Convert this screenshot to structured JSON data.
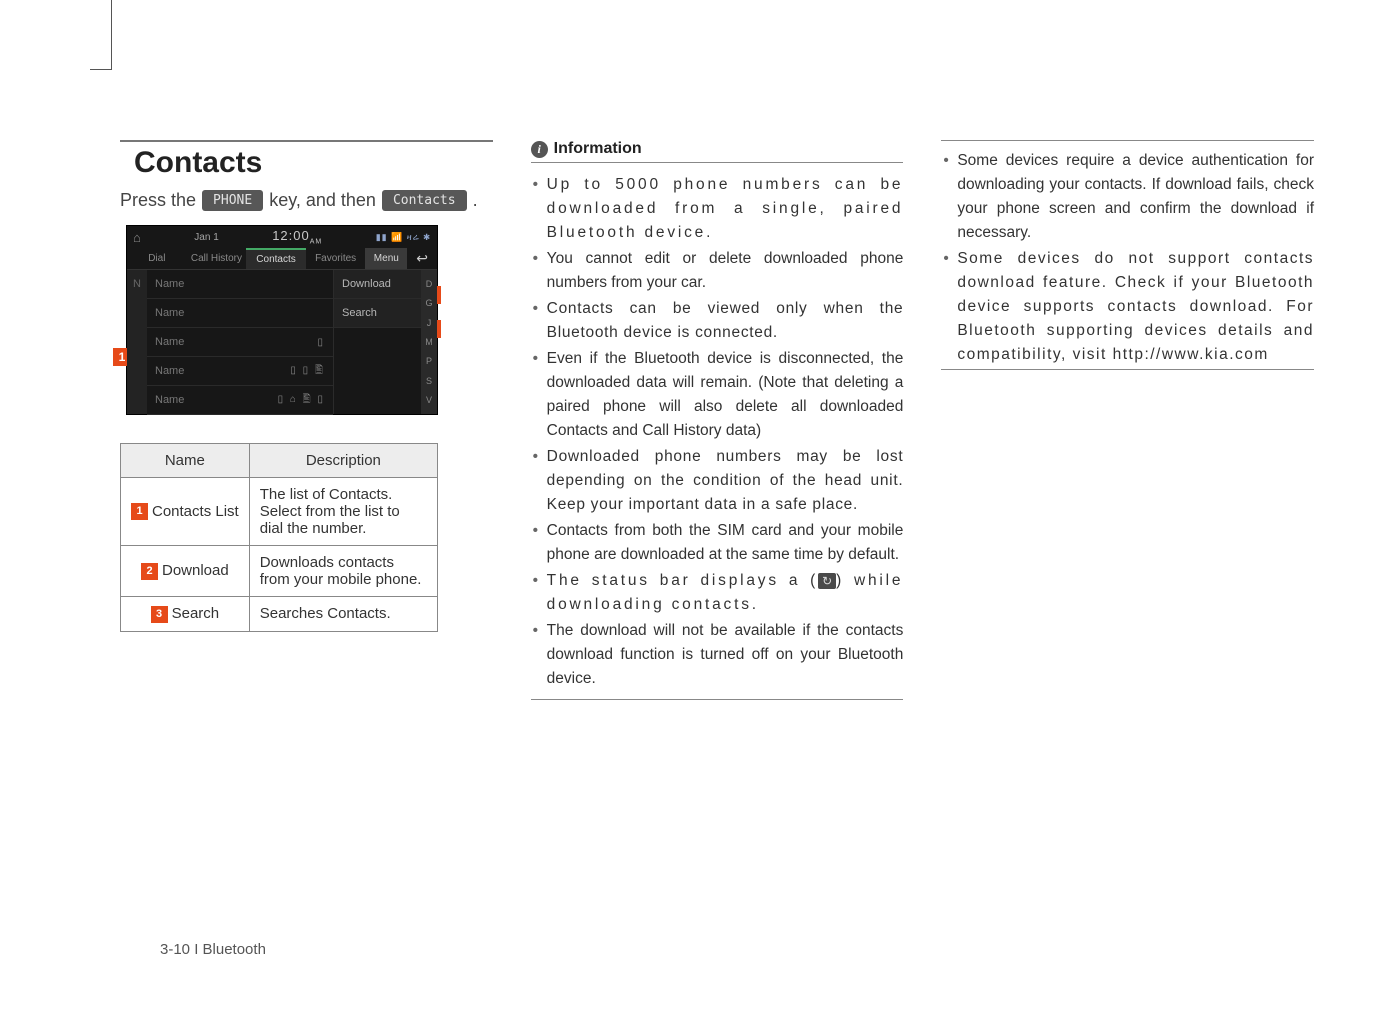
{
  "footer": "3-10 I Bluetooth",
  "section": {
    "title": "Contacts",
    "press_prefix": "Press the",
    "phone_key": "PHONE",
    "press_mid": "key, and then",
    "contacts_btn": "Contacts",
    "press_suffix": "."
  },
  "mock": {
    "home_icon": "⌂",
    "date": "Jan   1",
    "time": "12:00",
    "time_suffix": "AM",
    "status_icons": "▮▮ 📶 ዛሬ ✱",
    "tabs": [
      "Dial",
      "Call History",
      "Contacts",
      "Favorites",
      "Menu"
    ],
    "back_icon": "↩",
    "left_index": "N",
    "rows": [
      "Name",
      "Name",
      "Name",
      "Name",
      "Name"
    ],
    "row_icons": [
      "",
      "",
      "▯",
      "▯ ▯ 🖺",
      "▯ ⌂ 🖺 ▯"
    ],
    "buttons": [
      "Download",
      "Search"
    ],
    "az": [
      "D",
      "G",
      "J",
      "M",
      "P",
      "S",
      "V"
    ]
  },
  "table": {
    "headers": [
      "Name",
      "Description"
    ],
    "rows": [
      {
        "num": "1",
        "name": "Contacts List",
        "desc": "The list of Contacts. Select from the list to dial the number."
      },
      {
        "num": "2",
        "name": "Download",
        "desc": "Downloads contacts from your mobile phone."
      },
      {
        "num": "3",
        "name": "Search",
        "desc": "Searches Contacts."
      }
    ]
  },
  "info": {
    "heading": "Information",
    "col2": [
      "Up to 5000 phone numbers can be downloaded from a single, paired Bluetooth device.",
      "You cannot edit or delete downloaded phone numbers from your car.",
      "Contacts can be viewed only when the Bluetooth device is connected.",
      "Even if the Bluetooth device is disconnected, the downloaded data will remain. (Note that deleting a paired phone will also delete all downloaded Contacts and Call History data)",
      "Downloaded phone numbers may be lost depending on the condition of the head unit. Keep your important data in a safe place.",
      "Contacts from both the SIM card and your mobile phone are downloaded at the same time by default.",
      "The status bar displays a (",
      "The download will not be available if the contacts download function is turned off on your Bluetooth device."
    ],
    "col2_icon_suffix": ") while downloading contacts.",
    "col3": [
      "Some devices require a device authentication for downloading your contacts. If download fails, check your phone screen and confirm the download if necessary.",
      "Some devices do not support contacts download feature. Check if your Bluetooth device supports contacts download. For Bluetooth supporting devices details and compatibility, visit http://www.kia.com"
    ]
  }
}
